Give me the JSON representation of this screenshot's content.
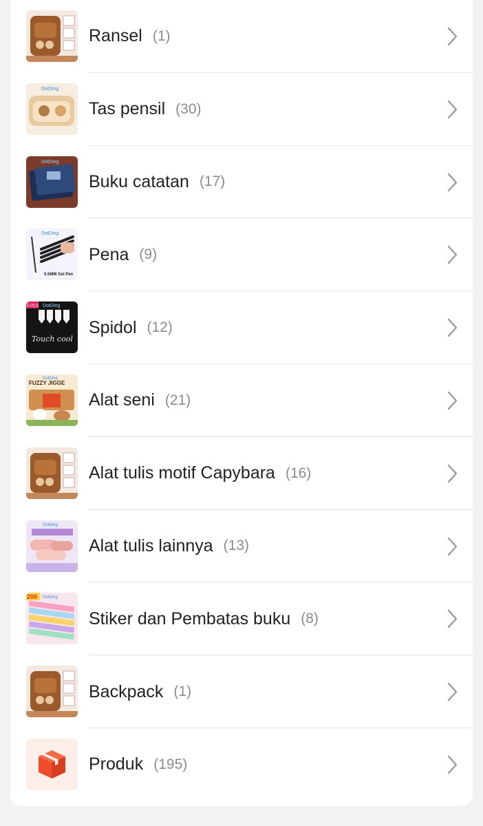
{
  "categories": [
    {
      "name": "Ransel",
      "count": "(1)",
      "thumb": "backpack-thumbnail"
    },
    {
      "name": "Tas pensil",
      "count": "(30)",
      "thumb": "pencil-case-thumbnail"
    },
    {
      "name": "Buku catatan",
      "count": "(17)",
      "thumb": "notebook-thumbnail"
    },
    {
      "name": "Pena",
      "count": "(9)",
      "thumb": "pen-thumbnail"
    },
    {
      "name": "Spidol",
      "count": "(12)",
      "thumb": "marker-thumbnail"
    },
    {
      "name": "Alat seni",
      "count": "(21)",
      "thumb": "art-tools-thumbnail"
    },
    {
      "name": "Alat tulis motif Capybara",
      "count": "(16)",
      "thumb": "capybara-stationery-thumbnail"
    },
    {
      "name": "Alat tulis lainnya",
      "count": "(13)",
      "thumb": "other-stationery-thumbnail"
    },
    {
      "name": "Stiker dan Pembatas buku",
      "count": "(8)",
      "thumb": "stickers-bookmarks-thumbnail"
    },
    {
      "name": "Backpack",
      "count": "(1)",
      "thumb": "backpack-thumbnail"
    },
    {
      "name": "Produk",
      "count": "(195)",
      "thumb": "box-icon"
    }
  ],
  "thumbnail_text": {
    "brand": "DotDing",
    "pen_caption": "0.5MM Gel Pen",
    "marker_caption": "Touch cool",
    "marker_badge": "5 PCS",
    "art_caption": "FUZZY JIGGE",
    "sticker_badge": "200"
  },
  "colors": {
    "background": "#f2f2f2",
    "card": "#ffffff",
    "text": "#222222",
    "count_text": "#8a8a8a",
    "divider": "#e6e6e6",
    "chevron": "#9a9a9a",
    "box_accent": "#ee4d2d",
    "box_bg": "#fdeeea"
  }
}
